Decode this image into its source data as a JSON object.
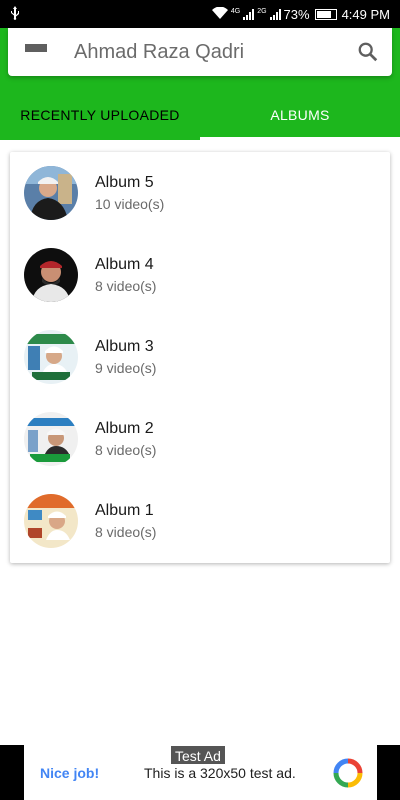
{
  "status_bar": {
    "usb_icon": "usb-icon",
    "wifi_icon": "wifi-icon",
    "net1": "4G",
    "net2": "2G",
    "battery_percent": "73%",
    "time": "4:49 PM"
  },
  "toolbar": {
    "title": "Ahmad Raza Qadri",
    "menu_icon": "menu-icon",
    "search_icon": "search-icon"
  },
  "tabs": [
    {
      "label": "RECENTLY UPLOADED",
      "selected": false
    },
    {
      "label": "ALBUMS",
      "selected": true
    }
  ],
  "albums": [
    {
      "name": "Album 5",
      "count": "10 video(s)"
    },
    {
      "name": "Album 4",
      "count": "8 video(s)"
    },
    {
      "name": "Album 3",
      "count": "9 video(s)"
    },
    {
      "name": "Album 2",
      "count": "8 video(s)"
    },
    {
      "name": "Album 1",
      "count": "8 video(s)"
    }
  ],
  "ad": {
    "tag": "Test Ad",
    "nice": "Nice job!",
    "text": "This is a 320x50 test ad."
  },
  "colors": {
    "header_green": "#1db71d",
    "tab_indicator": "#ffffff",
    "ad_link_blue": "#4285f4"
  }
}
